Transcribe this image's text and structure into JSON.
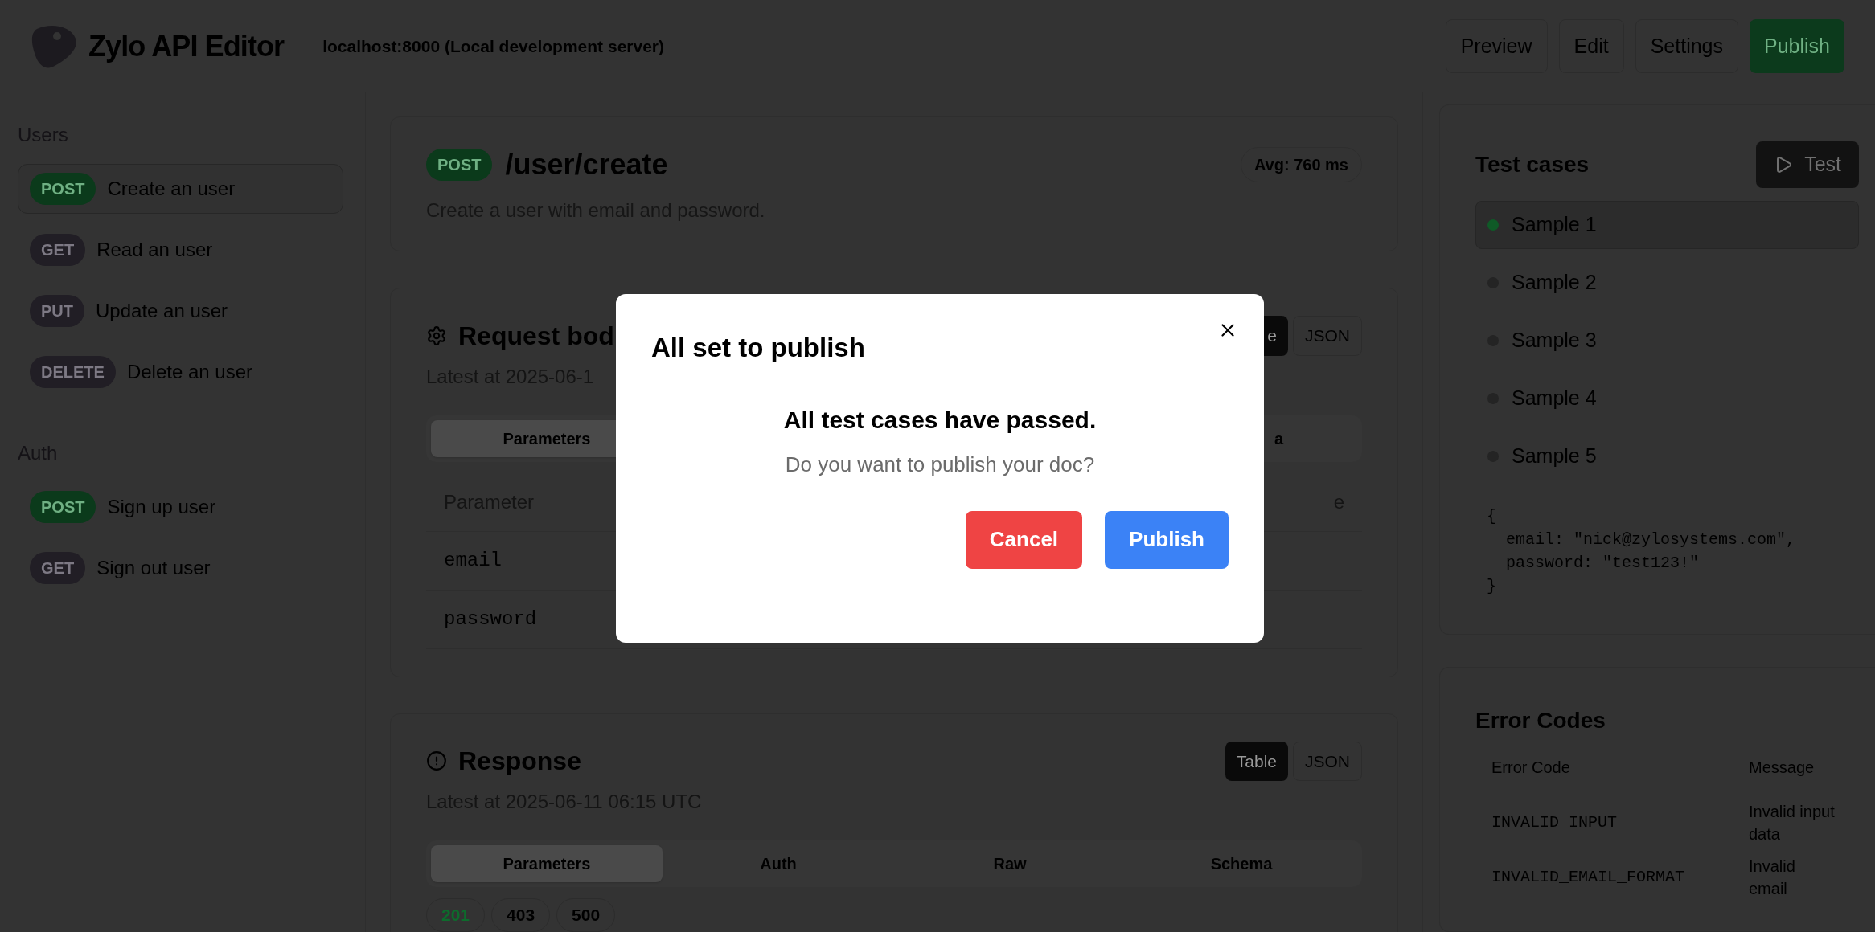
{
  "header": {
    "title": "Zylo API Editor",
    "server": "localhost:8000 (Local development server)",
    "nav": [
      {
        "label": "Preview",
        "kind": "plain"
      },
      {
        "label": "Edit",
        "kind": "plain"
      },
      {
        "label": "Settings",
        "kind": "plain"
      },
      {
        "label": "Publish",
        "kind": "primary"
      }
    ]
  },
  "sidebar": {
    "groups": [
      {
        "title": "Users",
        "items": [
          {
            "method": "POST",
            "label": "Create an user",
            "selected": true
          },
          {
            "method": "GET",
            "label": "Read an user",
            "selected": false
          },
          {
            "method": "PUT",
            "label": "Update an user",
            "selected": false
          },
          {
            "method": "DELETE",
            "label": "Delete an user",
            "selected": false
          }
        ]
      },
      {
        "title": "Auth",
        "items": [
          {
            "method": "POST",
            "label": "Sign up user",
            "selected": false
          },
          {
            "method": "GET",
            "label": "Sign out user",
            "selected": false
          }
        ]
      }
    ]
  },
  "endpoint": {
    "method": "POST",
    "path": "/user/create",
    "avg": "Avg: 760 ms",
    "description": "Create a user with email and password."
  },
  "request": {
    "title": "Request bod",
    "latest": "Latest at 2025-06-1",
    "toggle": [
      {
        "label": "e",
        "selected": true
      },
      {
        "label": "JSON",
        "selected": false
      }
    ],
    "tabs": [
      {
        "label": "Parameters",
        "selected": true
      },
      {
        "label": "a",
        "selected": false
      }
    ],
    "columns": [
      "Parameter",
      "e"
    ],
    "rows": [
      "email",
      "password"
    ]
  },
  "response": {
    "title": "Response",
    "latest": "Latest at 2025-06-11 06:15 UTC",
    "toggle": [
      {
        "label": "Table",
        "selected": true
      },
      {
        "label": "JSON",
        "selected": false
      }
    ],
    "tabs": [
      {
        "label": "Parameters",
        "selected": true
      },
      {
        "label": "Auth",
        "selected": false
      },
      {
        "label": "Raw",
        "selected": false
      },
      {
        "label": "Schema",
        "selected": false
      }
    ],
    "codes": [
      {
        "label": "201",
        "selected": true
      },
      {
        "label": "403",
        "selected": false
      },
      {
        "label": "500",
        "selected": false
      }
    ]
  },
  "test_cases": {
    "title": "Test cases",
    "button": "Test",
    "items": [
      {
        "label": "Sample 1",
        "selected": true,
        "color": "#0f5a27"
      },
      {
        "label": "Sample 2",
        "selected": false,
        "color": "#242424"
      },
      {
        "label": "Sample 3",
        "selected": false,
        "color": "#242424"
      },
      {
        "label": "Sample 4",
        "selected": false,
        "color": "#242424"
      },
      {
        "label": "Sample 5",
        "selected": false,
        "color": "#242424"
      }
    ],
    "code": [
      "{",
      "  email: \"nick@zylosystems.com\",",
      "  password: \"test123!\"",
      "}"
    ]
  },
  "error_codes": {
    "title": "Error Codes",
    "columns": [
      "Error Code",
      "Message"
    ],
    "rows": [
      {
        "code": "INVALID_INPUT",
        "message": "Invalid input data"
      },
      {
        "code": "INVALID_EMAIL_FORMAT",
        "message": "Invalid email"
      }
    ]
  },
  "dialog": {
    "title": "All set to publish",
    "heading": "All test cases have passed.",
    "message": "Do you want to publish your doc?",
    "buttons": [
      {
        "label": "Cancel",
        "kind": "danger"
      },
      {
        "label": "Publish",
        "kind": "primary"
      }
    ]
  }
}
